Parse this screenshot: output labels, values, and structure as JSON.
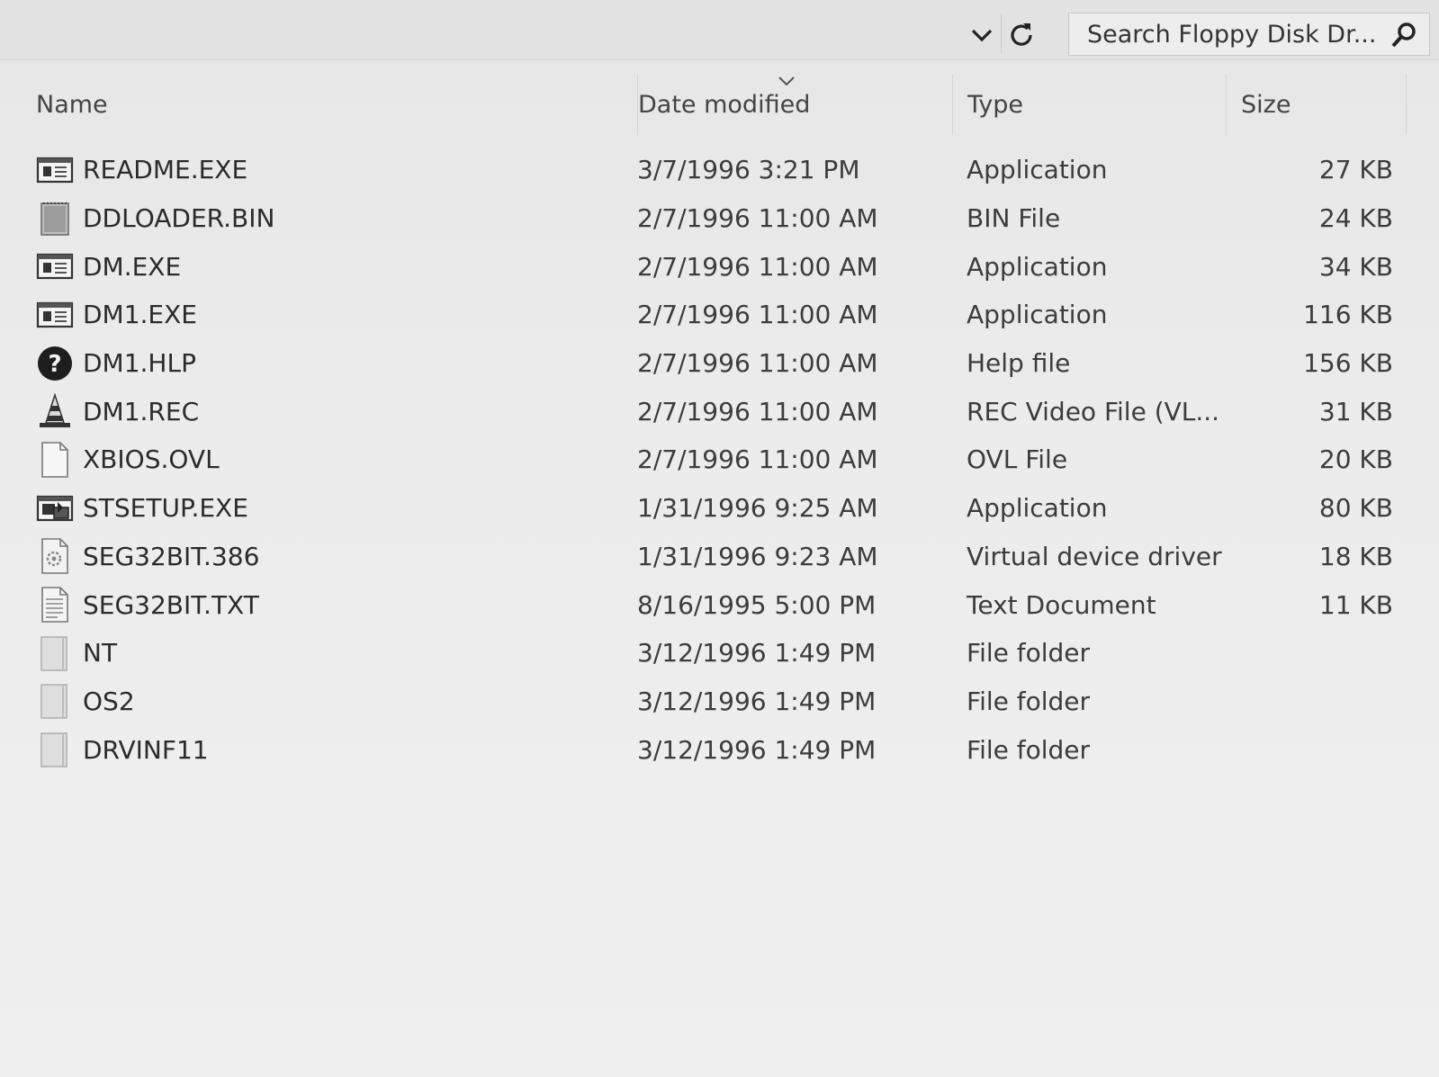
{
  "toolbar": {
    "search_placeholder": "Search Floppy Disk Dr..."
  },
  "columns": {
    "name": "Name",
    "date": "Date modified",
    "type": "Type",
    "size": "Size"
  },
  "files": [
    {
      "name": "README.EXE",
      "date": "3/7/1996 3:21 PM",
      "type": "Application",
      "size": "27 KB",
      "icon": "application-icon"
    },
    {
      "name": "DDLOADER.BIN",
      "date": "2/7/1996 11:00 AM",
      "type": "BIN File",
      "size": "24 KB",
      "icon": "binary-file-icon"
    },
    {
      "name": "DM.EXE",
      "date": "2/7/1996 11:00 AM",
      "type": "Application",
      "size": "34 KB",
      "icon": "application-icon"
    },
    {
      "name": "DM1.EXE",
      "date": "2/7/1996 11:00 AM",
      "type": "Application",
      "size": "116 KB",
      "icon": "application-icon"
    },
    {
      "name": "DM1.HLP",
      "date": "2/7/1996 11:00 AM",
      "type": "Help file",
      "size": "156 KB",
      "icon": "help-file-icon"
    },
    {
      "name": "DM1.REC",
      "date": "2/7/1996 11:00 AM",
      "type": "REC Video File (VL...",
      "size": "31 KB",
      "icon": "vlc-cone-icon"
    },
    {
      "name": "XBIOS.OVL",
      "date": "2/7/1996 11:00 AM",
      "type": "OVL File",
      "size": "20 KB",
      "icon": "blank-file-icon"
    },
    {
      "name": "STSETUP.EXE",
      "date": "1/31/1996 9:25 AM",
      "type": "Application",
      "size": "80 KB",
      "icon": "setup-application-icon"
    },
    {
      "name": "SEG32BIT.386",
      "date": "1/31/1996 9:23 AM",
      "type": "Virtual device driver",
      "size": "18 KB",
      "icon": "driver-file-icon"
    },
    {
      "name": "SEG32BIT.TXT",
      "date": "8/16/1995 5:00 PM",
      "type": "Text Document",
      "size": "11 KB",
      "icon": "text-document-icon"
    },
    {
      "name": "NT",
      "date": "3/12/1996 1:49 PM",
      "type": "File folder",
      "size": "",
      "icon": "folder-icon"
    },
    {
      "name": "OS2",
      "date": "3/12/1996 1:49 PM",
      "type": "File folder",
      "size": "",
      "icon": "folder-icon"
    },
    {
      "name": "DRVINF11",
      "date": "3/12/1996 1:49 PM",
      "type": "File folder",
      "size": "",
      "icon": "folder-icon"
    }
  ]
}
